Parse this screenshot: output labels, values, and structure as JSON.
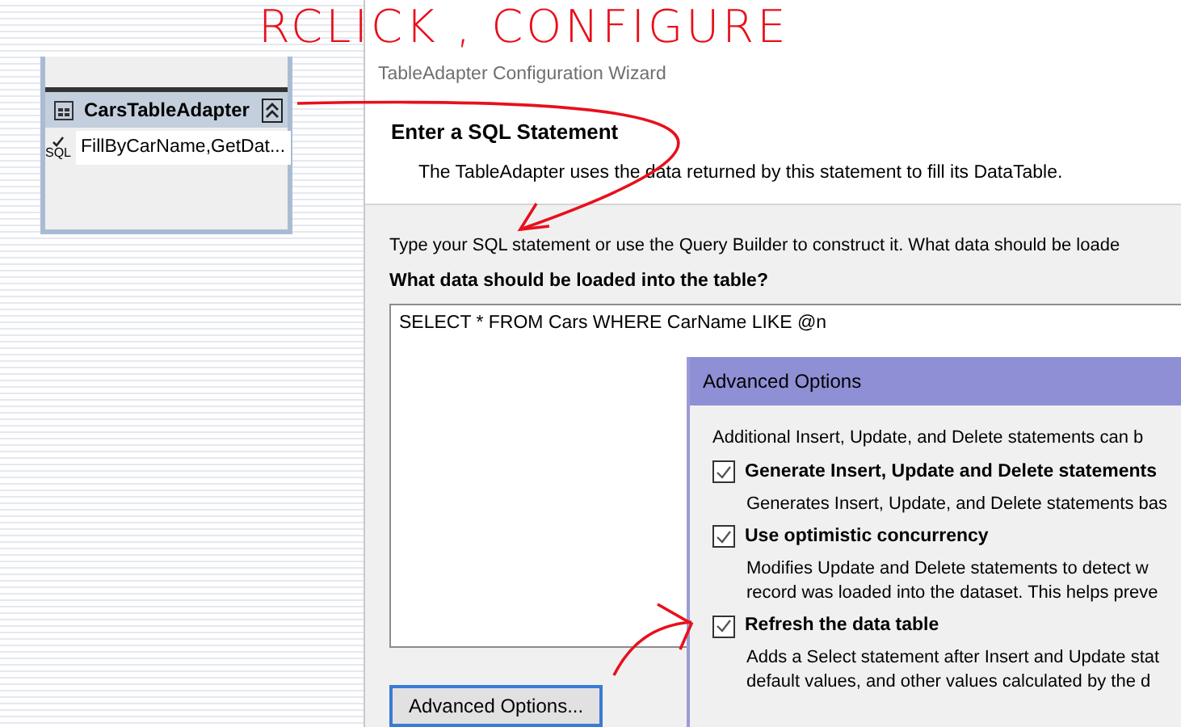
{
  "annotation": {
    "text": "RCLICK , CONFIGURE"
  },
  "designer": {
    "adapter": {
      "title": "CarsTableAdapter",
      "query_icon_label": "SQL",
      "queries": "FillByCarName,GetDat..."
    }
  },
  "wizard": {
    "title": "TableAdapter Configuration Wizard",
    "heading": "Enter a SQL Statement",
    "description": "The TableAdapter uses the data returned by this statement to fill its DataTable.",
    "instruction": "Type your SQL statement or use the Query Builder to construct it. What data should be loade",
    "label": "What data should be loaded into the table?",
    "sql": "SELECT * FROM Cars WHERE CarName LIKE @n",
    "advanced_button": "Advanced Options..."
  },
  "advanced_options": {
    "title": "Advanced Options",
    "intro": "Additional  Insert, Update, and Delete statements can b",
    "options": [
      {
        "label": "Generate Insert, Update and Delete statements",
        "checked": true,
        "description": [
          "Generates Insert, Update, and Delete statements bas"
        ]
      },
      {
        "label": "Use optimistic concurrency",
        "checked": true,
        "description": [
          "Modifies Update and Delete statements to detect w",
          "record was loaded into the dataset. This helps preve"
        ]
      },
      {
        "label": "Refresh the data table",
        "checked": true,
        "description": [
          "Adds a Select statement after Insert and Update stat",
          "default values, and other values calculated by the d"
        ]
      }
    ]
  }
}
